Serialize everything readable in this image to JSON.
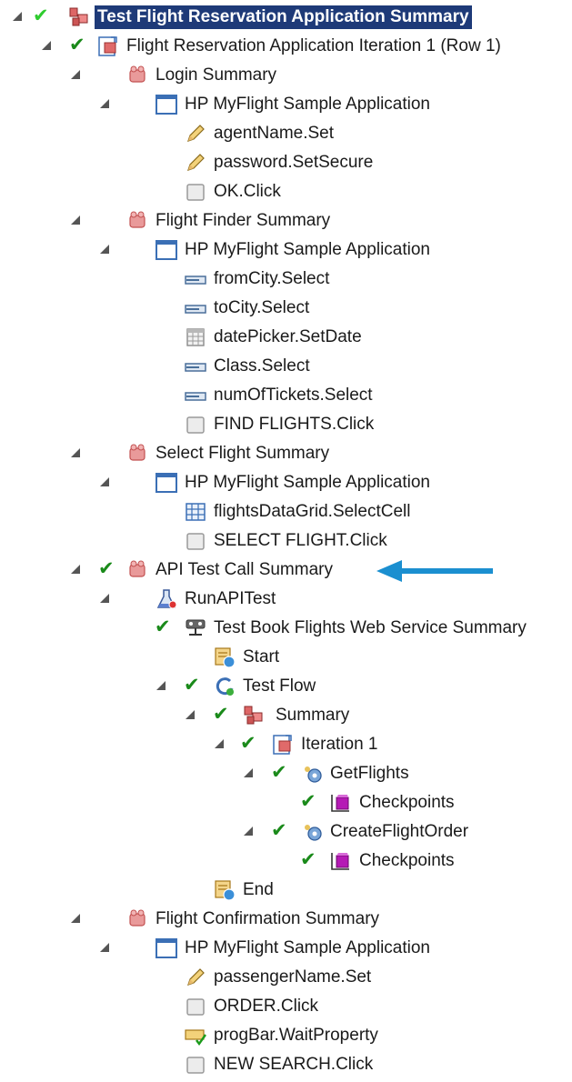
{
  "tree": {
    "nodes": [
      {
        "label": "Test Flight Reservation Application Summary",
        "icon": "summary-blocks-icon",
        "checked": true,
        "depth": 0,
        "selected": true
      },
      {
        "label": "Flight Reservation Application Iteration 1 (Row 1)",
        "icon": "iteration-icon",
        "checked": true,
        "depth": 1
      },
      {
        "label": "Login Summary",
        "icon": "action-icon",
        "checked": false,
        "depth": 2
      },
      {
        "label": "HP MyFlight Sample Application",
        "icon": "window-icon",
        "checked": false,
        "depth": 3
      },
      {
        "label": "agentName.Set",
        "icon": "pencil-icon",
        "checked": false,
        "depth": 4
      },
      {
        "label": "password.SetSecure",
        "icon": "pencil-icon",
        "checked": false,
        "depth": 4
      },
      {
        "label": "OK.Click",
        "icon": "button-icon",
        "checked": false,
        "depth": 4
      },
      {
        "label": "Flight Finder Summary",
        "icon": "action-icon",
        "checked": false,
        "depth": 2
      },
      {
        "label": "HP MyFlight Sample Application",
        "icon": "window-icon",
        "checked": false,
        "depth": 3
      },
      {
        "label": "fromCity.Select",
        "icon": "combobox-icon",
        "checked": false,
        "depth": 4
      },
      {
        "label": "toCity.Select",
        "icon": "combobox-icon",
        "checked": false,
        "depth": 4
      },
      {
        "label": "datePicker.SetDate",
        "icon": "calendar-icon",
        "checked": false,
        "depth": 4
      },
      {
        "label": "Class.Select",
        "icon": "combobox-icon",
        "checked": false,
        "depth": 4
      },
      {
        "label": "numOfTickets.Select",
        "icon": "combobox-icon",
        "checked": false,
        "depth": 4
      },
      {
        "label": "FIND FLIGHTS.Click",
        "icon": "button-icon",
        "checked": false,
        "depth": 4
      },
      {
        "label": "Select Flight Summary",
        "icon": "action-icon",
        "checked": false,
        "depth": 2
      },
      {
        "label": "HP MyFlight Sample Application",
        "icon": "window-icon",
        "checked": false,
        "depth": 3
      },
      {
        "label": "flightsDataGrid.SelectCell",
        "icon": "grid-icon",
        "checked": false,
        "depth": 4
      },
      {
        "label": "SELECT FLIGHT.Click",
        "icon": "button-icon",
        "checked": false,
        "depth": 4
      },
      {
        "label": "API Test Call Summary",
        "icon": "action-icon",
        "checked": true,
        "depth": 2
      },
      {
        "label": "RunAPITest",
        "icon": "flask-icon",
        "checked": false,
        "depth": 3
      },
      {
        "label": "Test Book Flights Web Service Summary",
        "icon": "web-service-icon",
        "checked": true,
        "depth": 4
      },
      {
        "label": "Start",
        "icon": "start-icon",
        "checked": false,
        "depth": 5
      },
      {
        "label": "Test Flow",
        "icon": "flow-icon",
        "checked": true,
        "depth": 6
      },
      {
        "label": "Summary",
        "icon": "summary-blocks-icon",
        "checked": true,
        "depth": 7
      },
      {
        "label": "Iteration 1",
        "icon": "iteration-icon",
        "checked": true,
        "depth": 8
      },
      {
        "label": "GetFlights",
        "icon": "gears-icon",
        "checked": true,
        "depth": 9
      },
      {
        "label": "Checkpoints",
        "icon": "checkpoint-icon",
        "checked": true,
        "depth": 10
      },
      {
        "label": "CreateFlightOrder",
        "icon": "gears-icon",
        "checked": true,
        "depth": 9
      },
      {
        "label": "Checkpoints",
        "icon": "checkpoint-icon",
        "checked": true,
        "depth": 10
      },
      {
        "label": "End",
        "icon": "end-icon",
        "checked": false,
        "depth": 5
      },
      {
        "label": "Flight Confirmation Summary",
        "icon": "action-icon",
        "checked": false,
        "depth": 2
      },
      {
        "label": "HP MyFlight Sample Application",
        "icon": "window-icon",
        "checked": false,
        "depth": 3
      },
      {
        "label": "passengerName.Set",
        "icon": "pencil-icon",
        "checked": false,
        "depth": 4
      },
      {
        "label": "ORDER.Click",
        "icon": "button-icon",
        "checked": false,
        "depth": 4
      },
      {
        "label": "progBar.WaitProperty",
        "icon": "wait-property-icon",
        "checked": false,
        "depth": 4
      },
      {
        "label": "NEW SEARCH.Click",
        "icon": "button-icon",
        "checked": false,
        "depth": 4
      }
    ]
  },
  "colors": {
    "selection": "#1e3a78",
    "check": "#1a8a1a",
    "arrow": "#1b8fd0"
  }
}
